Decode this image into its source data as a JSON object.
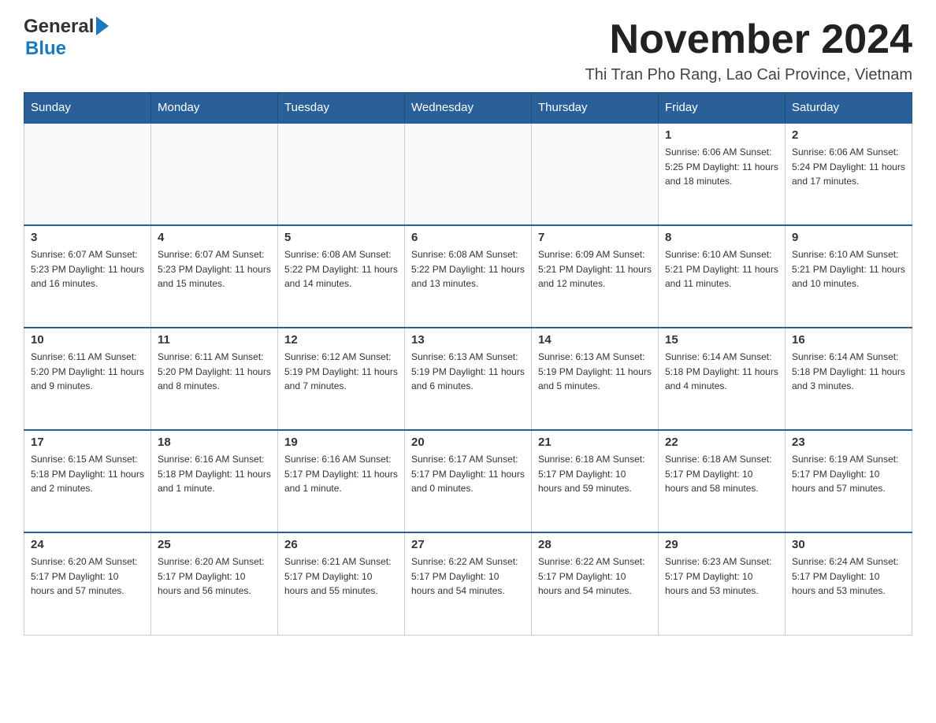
{
  "header": {
    "logo_general": "General",
    "logo_blue": "Blue",
    "main_title": "November 2024",
    "subtitle": "Thi Tran Pho Rang, Lao Cai Province, Vietnam"
  },
  "days_of_week": [
    "Sunday",
    "Monday",
    "Tuesday",
    "Wednesday",
    "Thursday",
    "Friday",
    "Saturday"
  ],
  "weeks": [
    {
      "days": [
        {
          "number": "",
          "info": ""
        },
        {
          "number": "",
          "info": ""
        },
        {
          "number": "",
          "info": ""
        },
        {
          "number": "",
          "info": ""
        },
        {
          "number": "",
          "info": ""
        },
        {
          "number": "1",
          "info": "Sunrise: 6:06 AM\nSunset: 5:25 PM\nDaylight: 11 hours\nand 18 minutes."
        },
        {
          "number": "2",
          "info": "Sunrise: 6:06 AM\nSunset: 5:24 PM\nDaylight: 11 hours\nand 17 minutes."
        }
      ]
    },
    {
      "days": [
        {
          "number": "3",
          "info": "Sunrise: 6:07 AM\nSunset: 5:23 PM\nDaylight: 11 hours\nand 16 minutes."
        },
        {
          "number": "4",
          "info": "Sunrise: 6:07 AM\nSunset: 5:23 PM\nDaylight: 11 hours\nand 15 minutes."
        },
        {
          "number": "5",
          "info": "Sunrise: 6:08 AM\nSunset: 5:22 PM\nDaylight: 11 hours\nand 14 minutes."
        },
        {
          "number": "6",
          "info": "Sunrise: 6:08 AM\nSunset: 5:22 PM\nDaylight: 11 hours\nand 13 minutes."
        },
        {
          "number": "7",
          "info": "Sunrise: 6:09 AM\nSunset: 5:21 PM\nDaylight: 11 hours\nand 12 minutes."
        },
        {
          "number": "8",
          "info": "Sunrise: 6:10 AM\nSunset: 5:21 PM\nDaylight: 11 hours\nand 11 minutes."
        },
        {
          "number": "9",
          "info": "Sunrise: 6:10 AM\nSunset: 5:21 PM\nDaylight: 11 hours\nand 10 minutes."
        }
      ]
    },
    {
      "days": [
        {
          "number": "10",
          "info": "Sunrise: 6:11 AM\nSunset: 5:20 PM\nDaylight: 11 hours\nand 9 minutes."
        },
        {
          "number": "11",
          "info": "Sunrise: 6:11 AM\nSunset: 5:20 PM\nDaylight: 11 hours\nand 8 minutes."
        },
        {
          "number": "12",
          "info": "Sunrise: 6:12 AM\nSunset: 5:19 PM\nDaylight: 11 hours\nand 7 minutes."
        },
        {
          "number": "13",
          "info": "Sunrise: 6:13 AM\nSunset: 5:19 PM\nDaylight: 11 hours\nand 6 minutes."
        },
        {
          "number": "14",
          "info": "Sunrise: 6:13 AM\nSunset: 5:19 PM\nDaylight: 11 hours\nand 5 minutes."
        },
        {
          "number": "15",
          "info": "Sunrise: 6:14 AM\nSunset: 5:18 PM\nDaylight: 11 hours\nand 4 minutes."
        },
        {
          "number": "16",
          "info": "Sunrise: 6:14 AM\nSunset: 5:18 PM\nDaylight: 11 hours\nand 3 minutes."
        }
      ]
    },
    {
      "days": [
        {
          "number": "17",
          "info": "Sunrise: 6:15 AM\nSunset: 5:18 PM\nDaylight: 11 hours\nand 2 minutes."
        },
        {
          "number": "18",
          "info": "Sunrise: 6:16 AM\nSunset: 5:18 PM\nDaylight: 11 hours\nand 1 minute."
        },
        {
          "number": "19",
          "info": "Sunrise: 6:16 AM\nSunset: 5:17 PM\nDaylight: 11 hours\nand 1 minute."
        },
        {
          "number": "20",
          "info": "Sunrise: 6:17 AM\nSunset: 5:17 PM\nDaylight: 11 hours\nand 0 minutes."
        },
        {
          "number": "21",
          "info": "Sunrise: 6:18 AM\nSunset: 5:17 PM\nDaylight: 10 hours\nand 59 minutes."
        },
        {
          "number": "22",
          "info": "Sunrise: 6:18 AM\nSunset: 5:17 PM\nDaylight: 10 hours\nand 58 minutes."
        },
        {
          "number": "23",
          "info": "Sunrise: 6:19 AM\nSunset: 5:17 PM\nDaylight: 10 hours\nand 57 minutes."
        }
      ]
    },
    {
      "days": [
        {
          "number": "24",
          "info": "Sunrise: 6:20 AM\nSunset: 5:17 PM\nDaylight: 10 hours\nand 57 minutes."
        },
        {
          "number": "25",
          "info": "Sunrise: 6:20 AM\nSunset: 5:17 PM\nDaylight: 10 hours\nand 56 minutes."
        },
        {
          "number": "26",
          "info": "Sunrise: 6:21 AM\nSunset: 5:17 PM\nDaylight: 10 hours\nand 55 minutes."
        },
        {
          "number": "27",
          "info": "Sunrise: 6:22 AM\nSunset: 5:17 PM\nDaylight: 10 hours\nand 54 minutes."
        },
        {
          "number": "28",
          "info": "Sunrise: 6:22 AM\nSunset: 5:17 PM\nDaylight: 10 hours\nand 54 minutes."
        },
        {
          "number": "29",
          "info": "Sunrise: 6:23 AM\nSunset: 5:17 PM\nDaylight: 10 hours\nand 53 minutes."
        },
        {
          "number": "30",
          "info": "Sunrise: 6:24 AM\nSunset: 5:17 PM\nDaylight: 10 hours\nand 53 minutes."
        }
      ]
    }
  ]
}
